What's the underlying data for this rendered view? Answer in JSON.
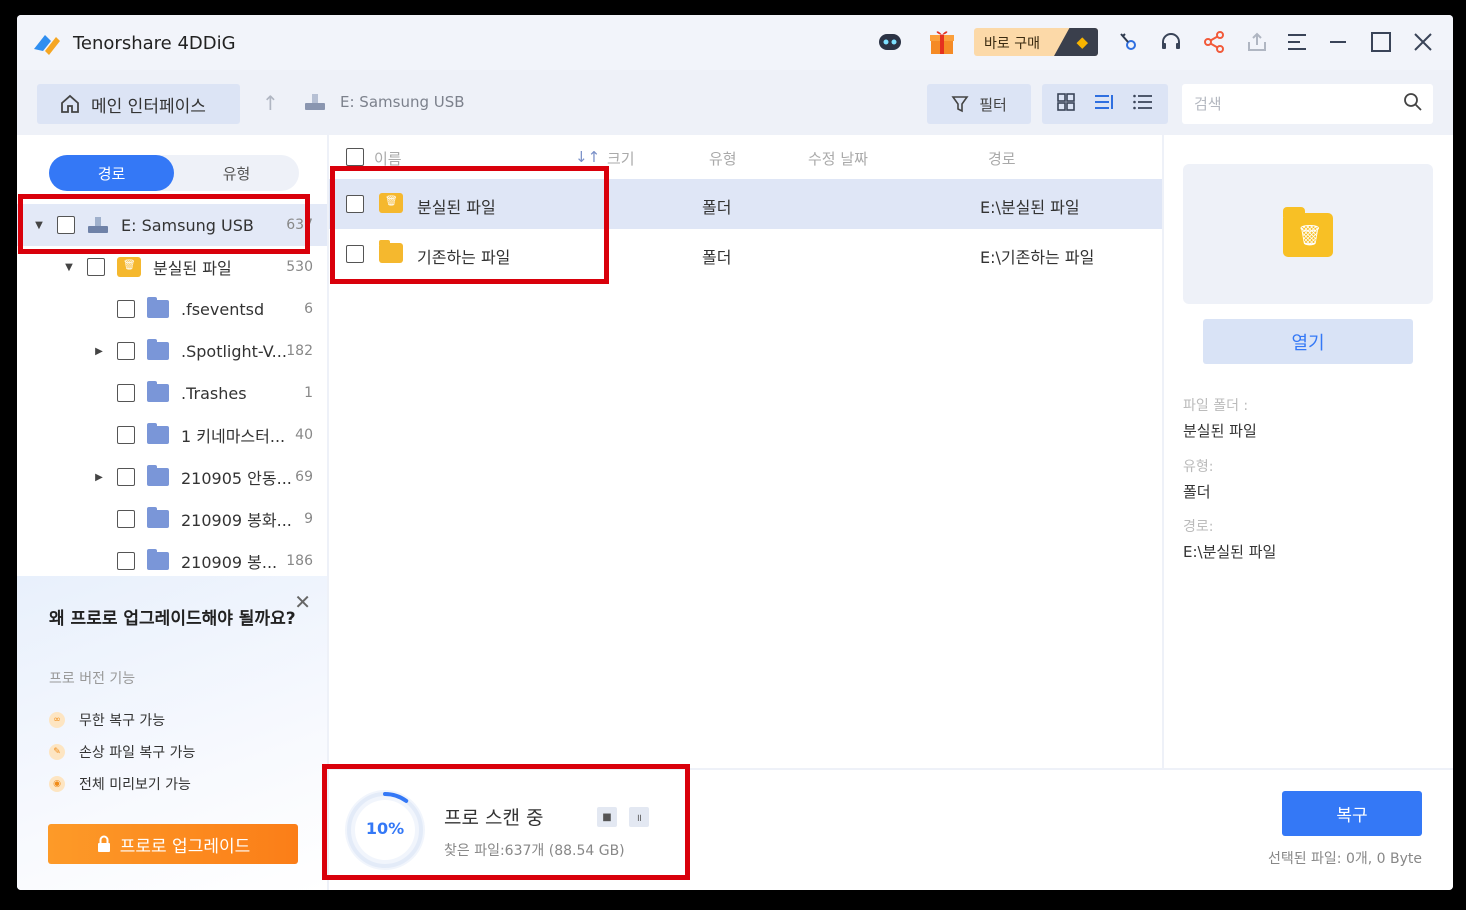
{
  "app": {
    "title": "Tenorshare 4DDiG",
    "buy_label": "바로 구매"
  },
  "titlebar_icons": [
    "robot-icon",
    "gift-icon",
    "key-icon",
    "headset-icon",
    "share-icon",
    "export-icon",
    "menu-icon",
    "minimize-icon",
    "maximize-icon",
    "close-icon"
  ],
  "toolbar": {
    "home_label": "메인 인터페이스",
    "drive_label": "E: Samsung USB",
    "filter_label": "필터",
    "search_placeholder": "검색"
  },
  "left": {
    "tab_path": "경로",
    "tab_type": "유형",
    "tree": [
      {
        "label": "E: Samsung USB",
        "count": "637"
      },
      {
        "label": "분실된 파일",
        "count": "530"
      },
      {
        "label": ".fseventsd",
        "count": "6"
      },
      {
        "label": ".Spotlight-V...",
        "count": "182"
      },
      {
        "label": ".Trashes",
        "count": "1"
      },
      {
        "label": "1 키네마스터...",
        "count": "40"
      },
      {
        "label": "210905 안동...",
        "count": "69"
      },
      {
        "label": "210909 봉화...",
        "count": "9"
      },
      {
        "label": "210909 봉...",
        "count": "186"
      }
    ]
  },
  "promo": {
    "heading": "왜 프로로 업그레이드해야 될까요?",
    "sub": "프로 버전 기능",
    "features": [
      "무한 복구 가능",
      "손상 파일 복구 가능",
      "전체 미리보기 가능"
    ],
    "button": "프로로 업그레이드"
  },
  "list": {
    "columns": [
      "이름",
      "크기",
      "유형",
      "수정 날짜",
      "경로"
    ],
    "rows": [
      {
        "name": "분실된 파일",
        "type": "폴더",
        "path": "E:\\분실된 파일"
      },
      {
        "name": "기존하는 파일",
        "type": "폴더",
        "path": "E:\\기존하는 파일"
      }
    ]
  },
  "details": {
    "open_label": "열기",
    "folder_label": "파일 폴더 :",
    "folder_value": "분실된 파일",
    "type_label": "유형:",
    "type_value": "폴더",
    "path_label": "경로:",
    "path_value": "E:\\분실된 파일"
  },
  "scan": {
    "percent": "10%",
    "progress": 0.1,
    "title": "프로 스캔 중",
    "found": "찾은 파일:637개 (88.54 GB)"
  },
  "footer": {
    "recover_label": "복구",
    "selected_info": "선택된 파일: 0개, 0 Byte"
  },
  "colors": {
    "accent": "#3478f6",
    "highlight": "#d9000b",
    "upgrade": "#fb7e18"
  }
}
